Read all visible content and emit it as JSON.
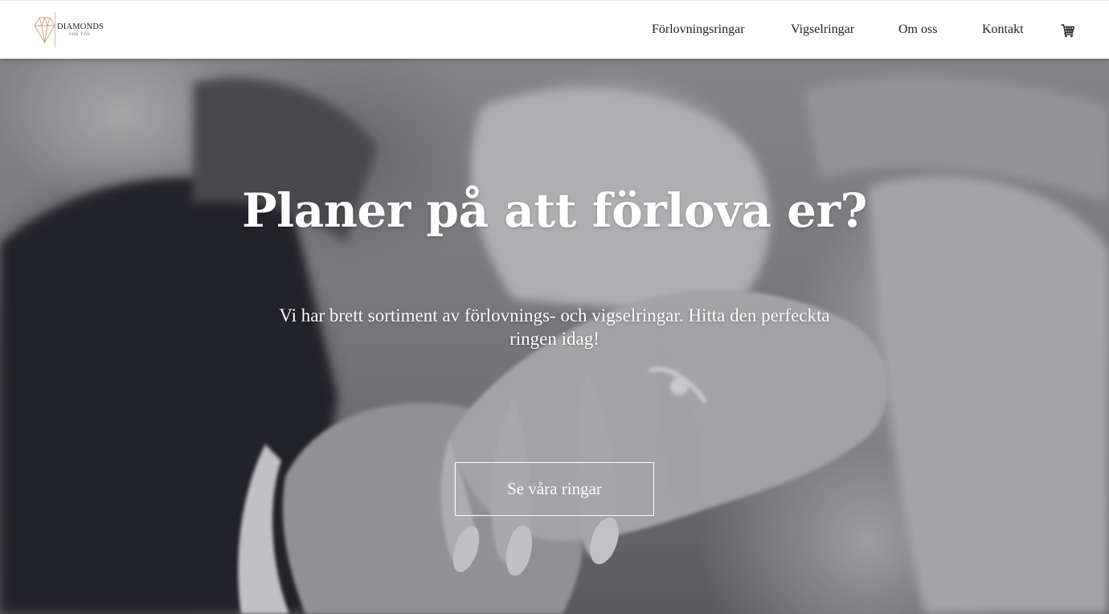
{
  "brand": {
    "name": "DIAMONDS",
    "tagline": "FOR YOU",
    "logo_icon": "diamond-logo-icon",
    "accent_color": "#c9a27a"
  },
  "nav": {
    "items": [
      {
        "label": "Förlovningsringar"
      },
      {
        "label": "Vigselringar"
      },
      {
        "label": "Om oss"
      },
      {
        "label": "Kontakt"
      }
    ],
    "cart_icon": "shopping-cart-icon"
  },
  "hero": {
    "title": "Planer på att förlova er?",
    "text": "Vi har brett sortiment av förlovnings- och vigselringar. Hitta den perfeckta ringen idag!",
    "button_label": "Se våra ringar"
  }
}
